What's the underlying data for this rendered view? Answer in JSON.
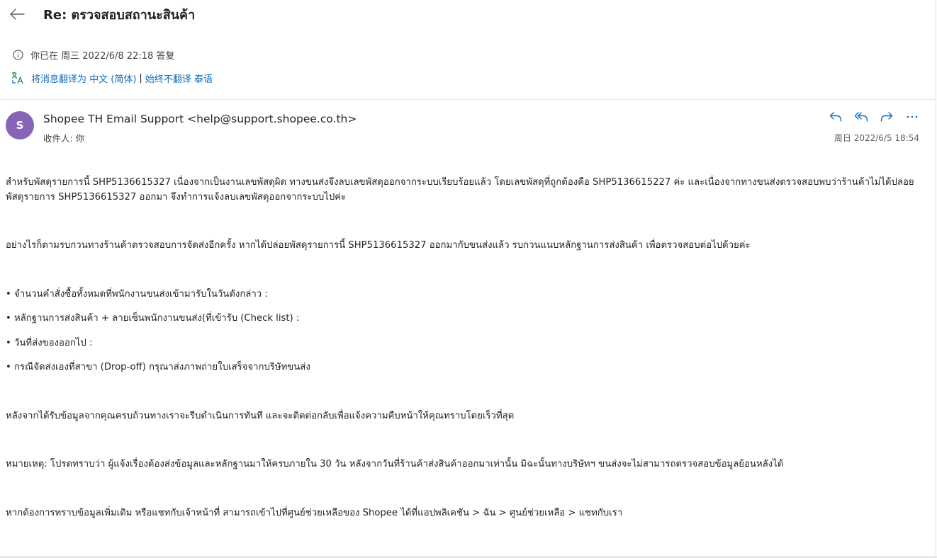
{
  "header": {
    "subject": "Re: ตรวจสอบสถานะสินค้า"
  },
  "info": {
    "replied_text": "你已在 周三 2022/6/8 22:18 答复"
  },
  "translate": {
    "translate_link": "将消息翻译为 中文 (简体)",
    "separator": "|",
    "never_link": "始终不翻译 泰语"
  },
  "message": {
    "avatar_initial": "S",
    "sender": "Shopee TH Email Support <help@support.shopee.co.th>",
    "recipient": "收件人:  你",
    "date": "周日 2022/6/5 18:54",
    "paragraphs": {
      "p1": "สำหรับพัสดุรายการนี้ SHP5136615327 เนื่องจากเป็นงานเลขพัสดุผิด ทางขนส่งจึงลบเลขพัสดุออกจากระบบเรียบร้อยแล้ว โดยเลขพัสดุที่ถูกต้องคือ SHP5136615227 ค่ะ และเนื่องจากทางขนส่งตรวจสอบพบว่าร้านค้าไม่ได้ปล่อยพัสดุรายการ SHP5136615327 ออกมา จึงทำการแจ้งลบเลขพัสดุออกจากระบบไปค่ะ",
      "p2": "อย่างไรก็ตามรบกวนทางร้านค้าตรวจสอบการจัดส่งอีกครั้ง หากได้ปล่อยพัสดุรายการนี้ SHP5136615327 ออกมากับขนส่งแล้ว รบกวนแนบหลักฐานการส่งสินค้า เพื่อตรวจสอบต่อไปด้วยค่ะ",
      "b1": "• จำนวนคำสั่งซื้อทั้งหมดที่พนักงานขนส่งเข้ามารับในวันดังกล่าว :",
      "b2": "• หลักฐานการส่งสินค้า + ลายเซ็นพนักงานขนส่ง(ที่เข้ารับ (Check list) :",
      "b3": "• วันที่ส่งของออกไป :",
      "b4": "• กรณีจัดส่งเองที่สาขา (Drop-off) กรุณาส่งภาพถ่ายใบเสร็จจากบริษัทขนส่ง",
      "p3": "หลังจากได้รับข้อมูลจากคุณครบถ้วนทางเราจะรีบดำเนินการทันที และจะติดต่อกลับเพื่อแจ้งความคืบหน้าให้คุณทราบโดยเร็วที่สุด",
      "p4": "หมายเหตุ: โปรดทราบว่า ผู้แจ้งเรื่องต้องส่งข้อมูลและหลักฐานมาให้ครบภายใน 30 วัน หลังจากวันที่ร้านค้าส่งสินค้าออกมาเท่านั้น มิฉะนั้นทางบริษัทฯ ขนส่งจะไม่สามารถตรวจสอบข้อมูลย้อนหลังได้",
      "p5": "หากต้องการทราบข้อมูลเพิ่มเติม หรือแชทกับเจ้าหน้าที่ สามารถเข้าไปที่ศูนย์ช่วยเหลือของ Shopee ได้ที่แอปพลิเคชัน > ฉัน > ศูนย์ช่วยเหลือ > แชทกับเรา"
    }
  },
  "icons": {
    "back": "back-arrow-icon",
    "info": "info-icon",
    "translate": "translate-icon",
    "reply": "reply-icon",
    "reply_all": "reply-all-icon",
    "forward": "forward-icon",
    "more": "more-icon"
  },
  "colors": {
    "accent": "#0f6cbd",
    "avatar": "#8764b8",
    "translate_green": "#2e8b3e"
  }
}
